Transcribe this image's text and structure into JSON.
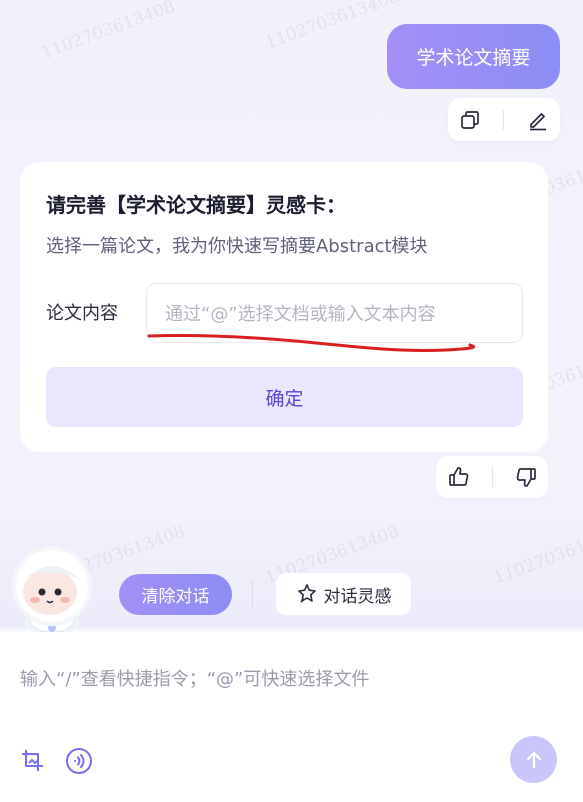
{
  "watermark": {
    "text": "1102703613408",
    "instances": [
      "a",
      "b",
      "c",
      "d",
      "e",
      "f",
      "g",
      "h",
      "i",
      "j",
      "k",
      "l",
      "m",
      "n",
      "o",
      "p"
    ]
  },
  "user_message": {
    "text": "学术论文摘要",
    "actions": [
      {
        "name": "copy",
        "icon": "copy-icon"
      },
      {
        "name": "edit",
        "icon": "pencil-icon"
      }
    ]
  },
  "card": {
    "title": "请完善【学术论文摘要】灵感卡：",
    "description": "选择一篇论文，我为你快速写摘要Abstract模块",
    "field_label": "论文内容",
    "field_placeholder": "通过“@”选择文档或输入文本内容",
    "confirm_label": "确定",
    "annotation_color": "#d91f1f"
  },
  "feedback": [
    {
      "name": "like",
      "icon": "thumbs-up-icon"
    },
    {
      "name": "dislike",
      "icon": "thumbs-down-icon"
    }
  ],
  "toolbar": {
    "clear_label": "清除对话",
    "inspire_label": "对话灵感",
    "inspire_icon": "sparkle-icon"
  },
  "composer": {
    "placeholder": "输入“/”查看快捷指令；“@”可快速选择文件",
    "tools": [
      "crop-image-icon",
      "voice-icon"
    ],
    "send_icon": "arrow-up-icon"
  },
  "colors": {
    "accent": "#8b8ef5",
    "accent_light": "#e9e7fd",
    "accent_text": "#5a46d8"
  }
}
